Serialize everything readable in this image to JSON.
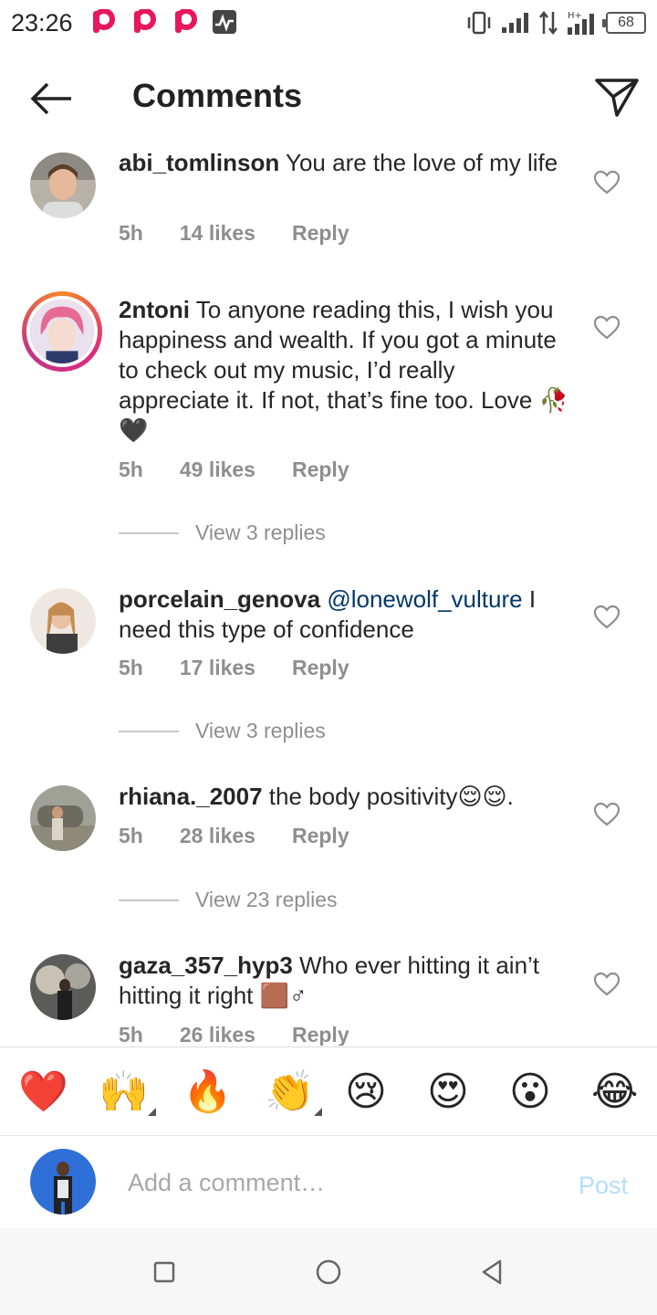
{
  "status_bar": {
    "time": "23:26",
    "battery": "68",
    "icons": [
      "p-app-icon",
      "p-app-icon",
      "p-app-icon",
      "activity-icon",
      "vibrate-icon",
      "signal-icon",
      "data-arrows-icon",
      "hplus-signal-icon",
      "battery-icon"
    ]
  },
  "header": {
    "title": "Comments",
    "back_icon": "arrow-left-icon",
    "share_icon": "send-icon"
  },
  "comments": [
    {
      "username": "abi_tomlinson",
      "text": " You are the love of my life",
      "time": "5h",
      "likes": "14 likes",
      "reply": "Reply"
    },
    {
      "username": "2ntoni",
      "text": " To anyone reading this, I wish you happiness and wealth. If you got a minute to check out my music, I’d really appreciate it. If not, that’s fine too. Love 🥀🖤",
      "time": "5h",
      "likes": "49 likes",
      "reply": "Reply",
      "view_replies": "View 3 replies"
    },
    {
      "username": "porcelain_genova",
      "mention": "@lonewolf_vulture",
      "text": " I need this type of confidence",
      "time": "5h",
      "likes": "17 likes",
      "reply": "Reply",
      "view_replies": "View 3 replies"
    },
    {
      "username": "rhiana._2007",
      "text": " the body positivity😌😌.",
      "time": "5h",
      "likes": "28 likes",
      "reply": "Reply",
      "view_replies": "View 23 replies"
    },
    {
      "username": "gaza_357_hyp3",
      "text": " Who ever hitting it ain’t hitting it right 🟫♂",
      "time": "5h",
      "likes": "26 likes",
      "reply": "Reply"
    }
  ],
  "reactions": [
    "❤️",
    "🙌",
    "🔥",
    "👏",
    "😢",
    "😍",
    "😮",
    "😂"
  ],
  "composer": {
    "placeholder": "Add a comment…",
    "post_label": "Post"
  },
  "colors": {
    "accent_post_disabled": "#b2dffc",
    "meta_gray": "#8e8e8e",
    "mention_blue": "#00376b"
  }
}
